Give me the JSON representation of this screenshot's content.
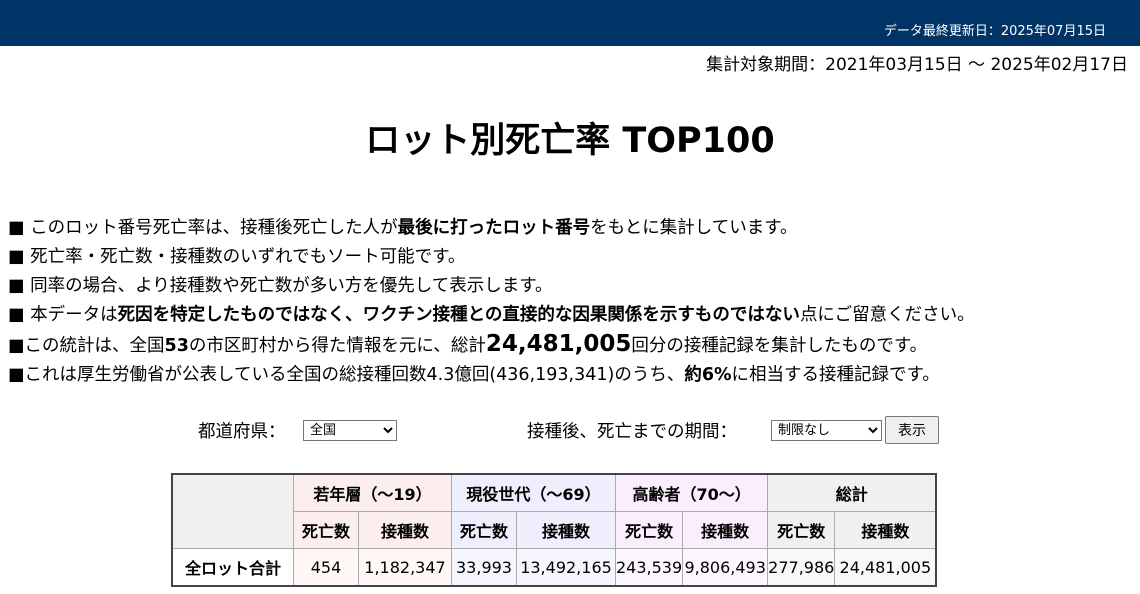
{
  "header": {
    "updated": "データ最終更新日：2025年07月15日",
    "period": "集計対象期間：2021年03月15日 〜 2025年02月17日"
  },
  "title": "ロット別死亡率 TOP100",
  "notes": {
    "n1_a": "■ このロット番号死亡率は、接種後死亡した人が",
    "n1_b": "最後に打ったロット番号",
    "n1_c": "をもとに集計しています。",
    "n2": "■ 死亡率・死亡数・接種数のいずれでもソート可能です。",
    "n3": "■ 同率の場合、より接種数や死亡数が多い方を優先して表示します。",
    "n4_a": "■ 本データは",
    "n4_b": "死因を特定したものではなく、ワクチン接種との直接的な因果関係を示すものではない",
    "n4_c": "点にご留意ください。",
    "n5_a": "■この統計は、全国",
    "n5_b": "53",
    "n5_c": "の市区町村から得た情報を元に、総計",
    "n5_d": "24,481,005",
    "n5_e": "回分の接種記録を集計したものです。",
    "n6_a": "■これは厚生労働省が公表している全国の総接種回数4.3億回(436,193,341)のうち、",
    "n6_b": "約6%",
    "n6_c": "に相当する接種記録です。"
  },
  "controls": {
    "prefecture_label": "都道府県：",
    "prefecture_value": "全国",
    "period_label": "接種後、死亡までの期間：",
    "period_value": "制限なし",
    "show_button": "表示"
  },
  "table": {
    "groups": {
      "young": "若年層（〜19）",
      "working": "現役世代（〜69）",
      "elderly": "高齢者（70〜）",
      "total": "総計"
    },
    "subheaders": {
      "deaths": "死亡数",
      "vaccinations": "接種数"
    },
    "row": {
      "label": "全ロット合計",
      "young_deaths": "454",
      "young_vacc": "1,182,347",
      "working_deaths": "33,993",
      "working_vacc": "13,492,165",
      "elderly_deaths": "243,539",
      "elderly_vacc": "9,806,493",
      "total_deaths": "277,986",
      "total_vacc": "24,481,005"
    }
  }
}
